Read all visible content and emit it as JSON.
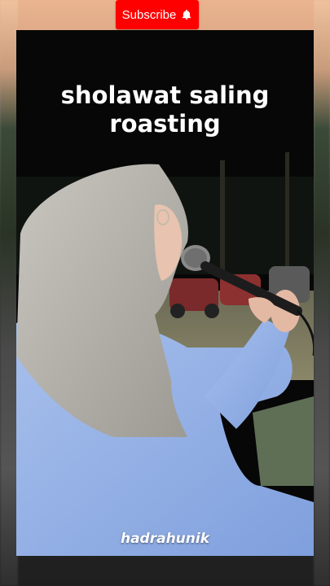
{
  "subscribe": {
    "label": "Subscribe",
    "icon": "bell-icon",
    "color": "#ff0000"
  },
  "video": {
    "title_line1": "sholawat saling",
    "title_line2": "roasting",
    "watermark": "hadrahunik"
  }
}
